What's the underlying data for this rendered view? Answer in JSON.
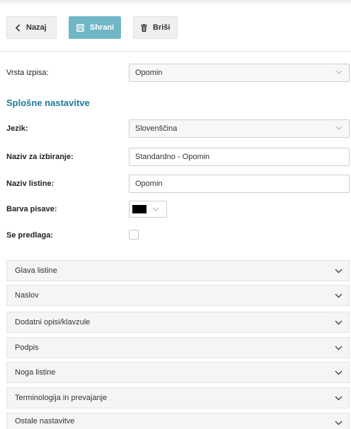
{
  "toolbar": {
    "back_label": "Nazaj",
    "save_label": "Shrani",
    "delete_label": "Briši"
  },
  "report_type": {
    "label": "Vrsta izpisa:",
    "value": "Opomin"
  },
  "general_section": {
    "title": "Splošne nastavitve",
    "language": {
      "label": "Jezik:",
      "value": "Slovenščina"
    },
    "selection_name": {
      "label": "Naziv za izbiranje:",
      "value": "Standardno - Opomin"
    },
    "document_name": {
      "label": "Naziv listine:",
      "value": "Opomin"
    },
    "font_color": {
      "label": "Barva pisave:",
      "color": "#000000"
    },
    "default": {
      "label": "Se predlaga:",
      "checked": false
    }
  },
  "accordion": [
    {
      "label": "Glava listine"
    },
    {
      "label": "Naslov"
    },
    {
      "label": "Dodatni opisi/klavzule"
    },
    {
      "label": "Podpis"
    },
    {
      "label": "Noga listine"
    },
    {
      "label": "Terminologija in prevajanje"
    },
    {
      "label": "Ostale nastavitve"
    }
  ],
  "colors": {
    "accent": "#1b7a97",
    "save_button": "#6fb7c7"
  }
}
